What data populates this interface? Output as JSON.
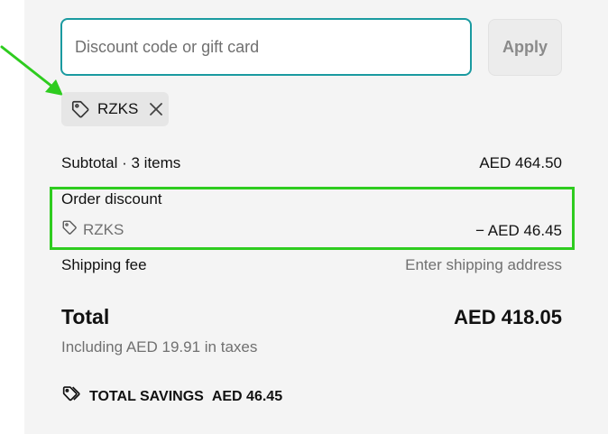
{
  "discount": {
    "placeholder": "Discount code or gift card",
    "apply_label": "Apply",
    "applied_code": "RZKS"
  },
  "summary": {
    "subtotal_label": "Subtotal · 3 items",
    "subtotal_value": "AED 464.50",
    "order_discount_label": "Order discount",
    "order_discount_code": "RZKS",
    "order_discount_value": "− AED 46.45",
    "shipping_label": "Shipping fee",
    "shipping_value": "Enter shipping address",
    "total_label": "Total",
    "total_value": "AED 418.05",
    "tax_note": "Including AED 19.91 in taxes",
    "savings_label": "TOTAL SAVINGS",
    "savings_value": "AED 46.45"
  },
  "colors": {
    "input_focus_border": "#1a9aa0",
    "annotation_green": "#2ecc1f",
    "panel_background": "#f4f4f4"
  },
  "icons": [
    "tag-icon",
    "close-icon",
    "tags-icon"
  ]
}
